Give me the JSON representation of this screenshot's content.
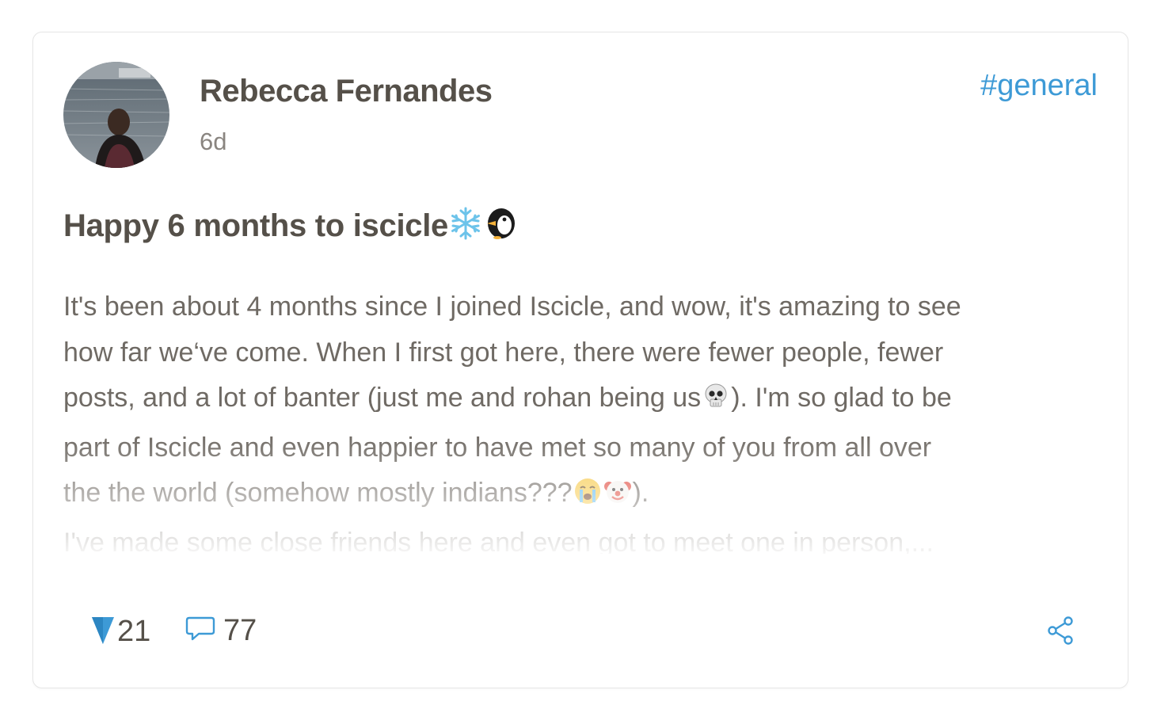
{
  "post": {
    "author": "Rebecca Fernandes",
    "time": "6d",
    "channel": "#general",
    "title": "Happy 6 months to iscicle",
    "title_emojis": [
      "snowflake-emoji",
      "penguin-emoji"
    ],
    "body_lines": [
      "It's been about 4 months since I joined Iscicle, and wow, it's amazing to see",
      "how far we‘ve come. When I first got here, there were fewer people, fewer",
      "posts, and a lot of banter (just me and rohan being us",
      "). I'm so glad to be",
      "part of Iscicle and even happier to have met so many of you from all over",
      "the the world (somehow mostly indians???",
      ").",
      "I've made some close friends here and even got to meet one in person,..."
    ],
    "body_emojis": [
      "skull-emoji",
      "crying-face-emoji",
      "clown-face-emoji"
    ]
  },
  "footer": {
    "votes": "21",
    "comments": "77"
  },
  "colors": {
    "accent": "#3d9ad6",
    "text_dark": "#555049",
    "text_body": "#6f6a64",
    "card_border": "#e6e6e6"
  },
  "icons": [
    "avatar-photo",
    "upvote-icon",
    "comment-icon",
    "share-icon"
  ]
}
